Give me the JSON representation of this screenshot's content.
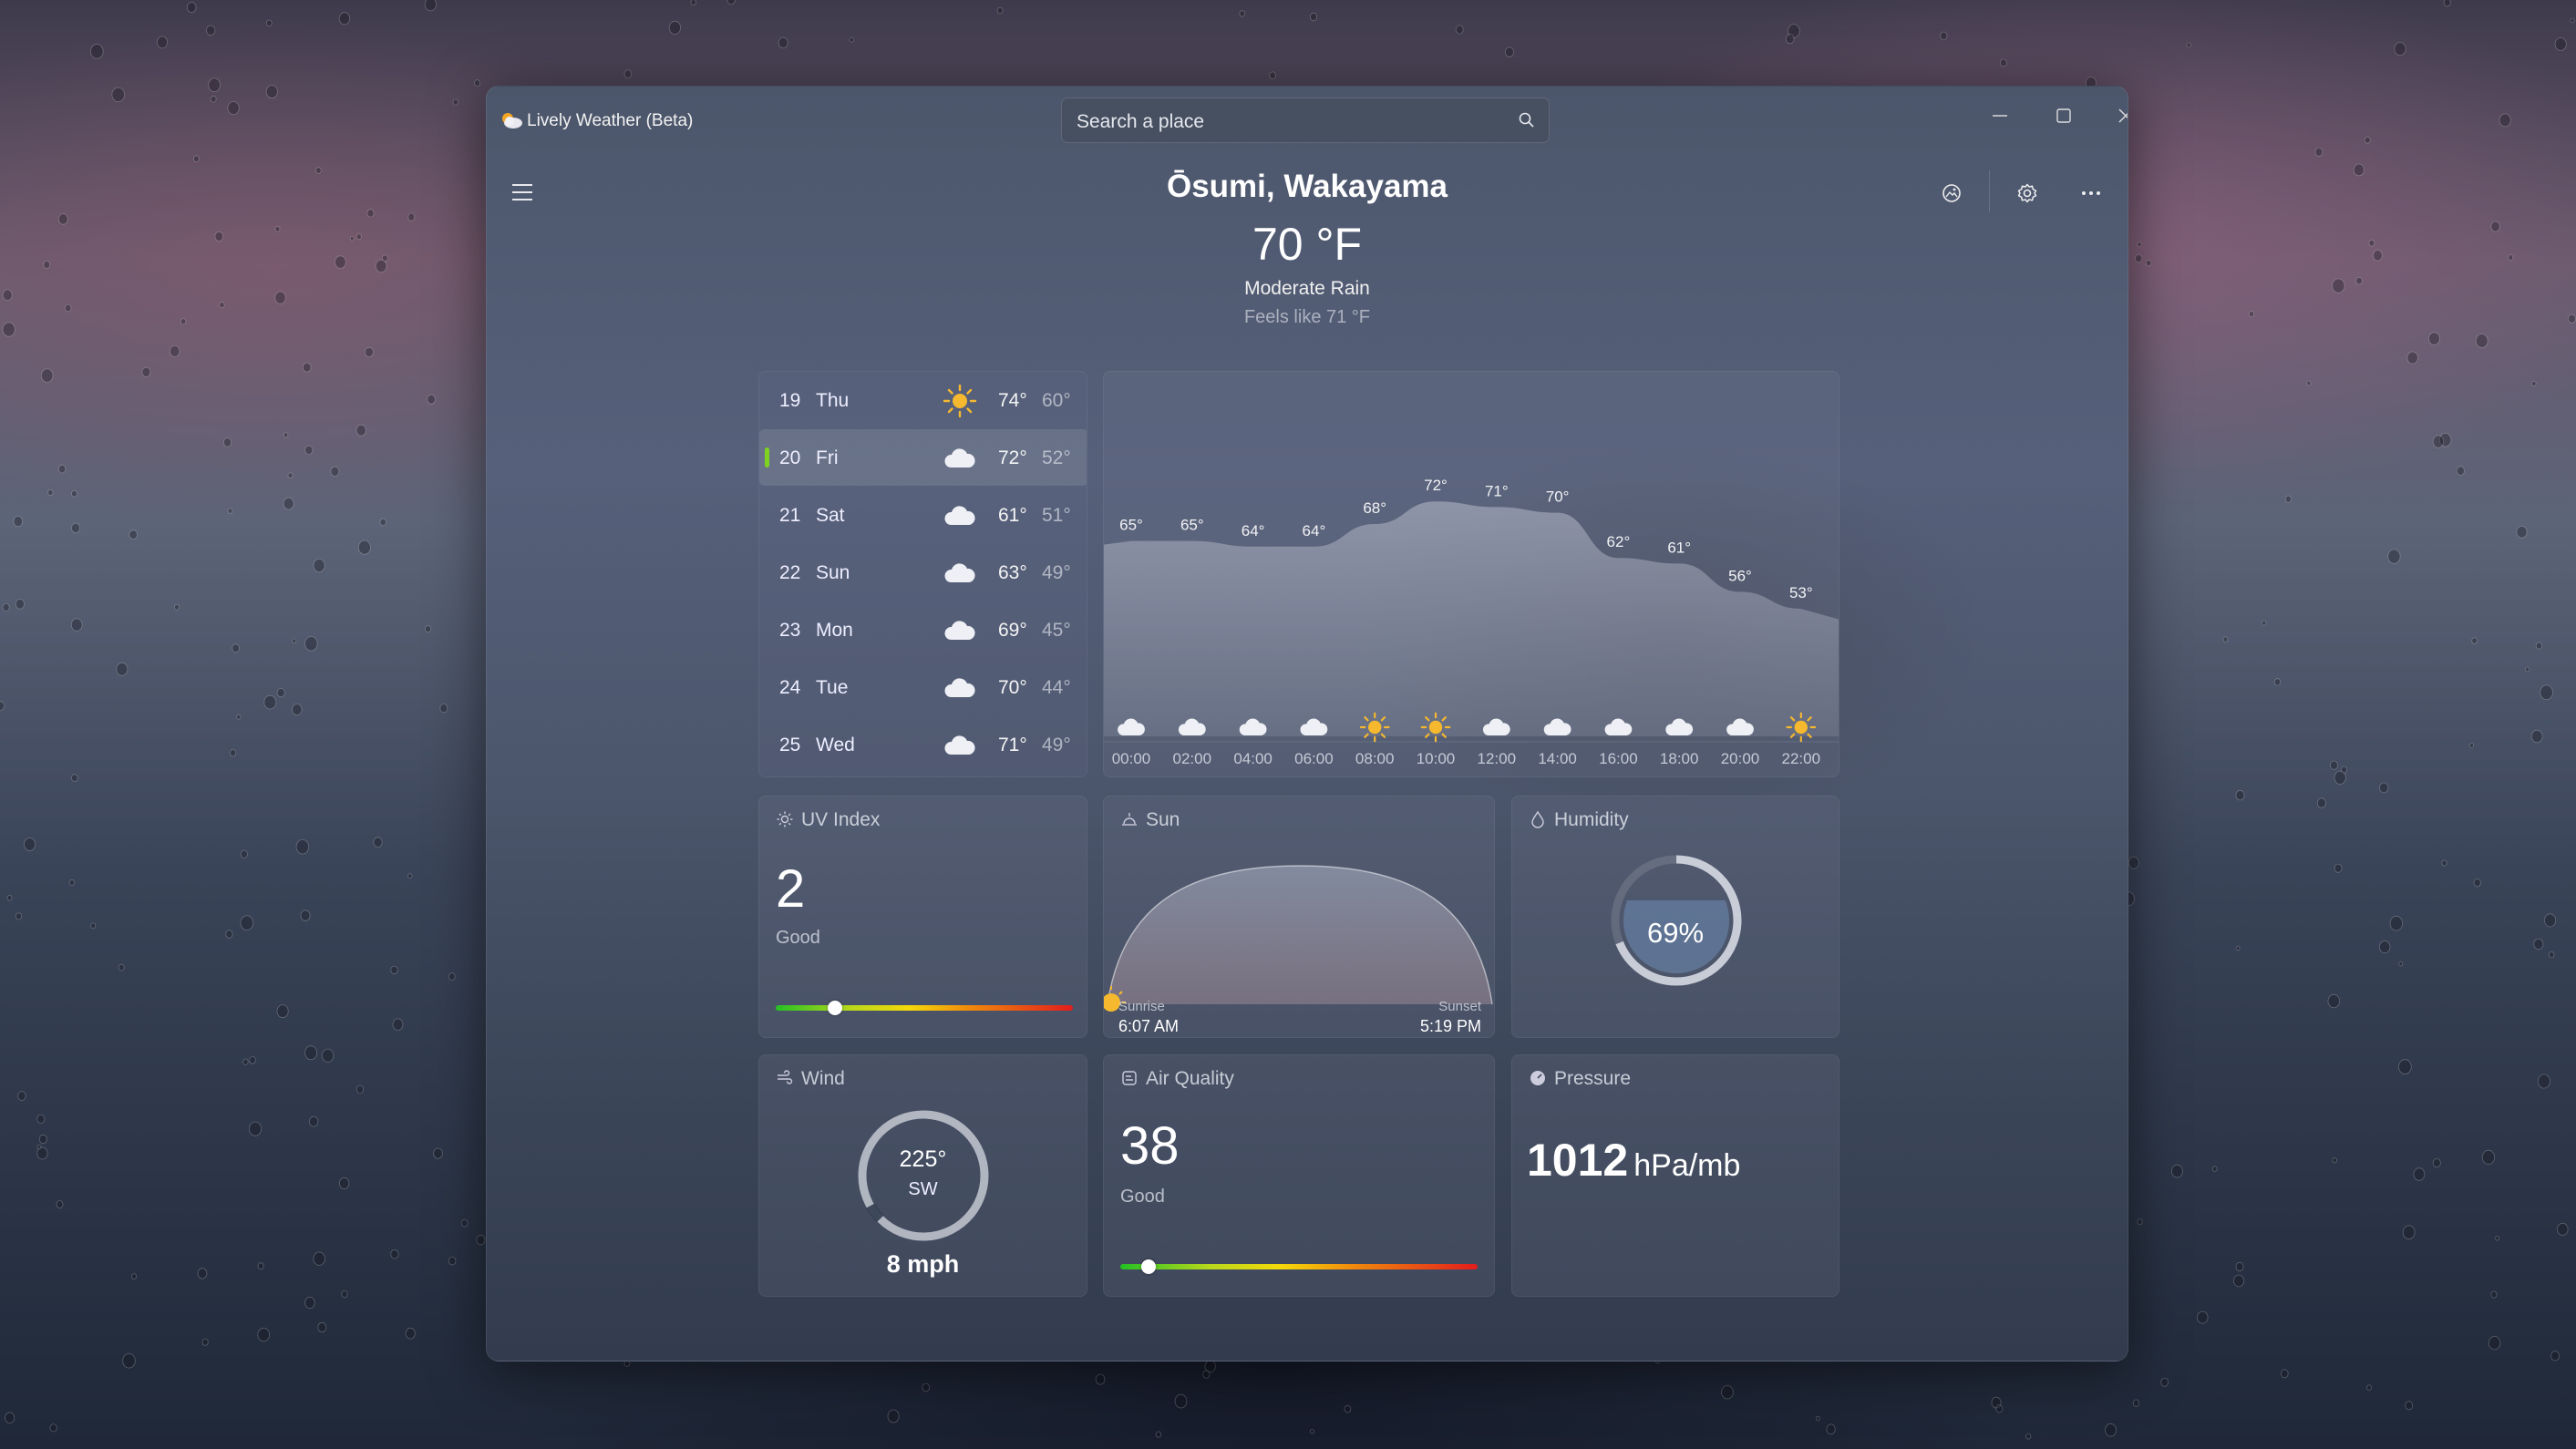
{
  "window": {
    "title": "Lively Weather (Beta)"
  },
  "search": {
    "placeholder": "Search a place"
  },
  "current": {
    "location": "Ōsumi, Wakayama",
    "temperature": "70 °F",
    "condition": "Moderate Rain",
    "feels_like": "Feels like 71 °F"
  },
  "forecast": [
    {
      "day": "19",
      "name": "Thu",
      "icon": "sun-icon",
      "high": "74°",
      "low": "60°",
      "selected": false
    },
    {
      "day": "20",
      "name": "Fri",
      "icon": "cloud-icon",
      "high": "72°",
      "low": "52°",
      "selected": true
    },
    {
      "day": "21",
      "name": "Sat",
      "icon": "cloud-icon",
      "high": "61°",
      "low": "51°",
      "selected": false
    },
    {
      "day": "22",
      "name": "Sun",
      "icon": "cloud-icon",
      "high": "63°",
      "low": "49°",
      "selected": false
    },
    {
      "day": "23",
      "name": "Mon",
      "icon": "cloud-icon",
      "high": "69°",
      "low": "45°",
      "selected": false
    },
    {
      "day": "24",
      "name": "Tue",
      "icon": "cloud-icon",
      "high": "70°",
      "low": "44°",
      "selected": false
    },
    {
      "day": "25",
      "name": "Wed",
      "icon": "cloud-icon",
      "high": "71°",
      "low": "49°",
      "selected": false
    }
  ],
  "hourly": {
    "times": [
      "00:00",
      "02:00",
      "04:00",
      "06:00",
      "08:00",
      "10:00",
      "12:00",
      "14:00",
      "16:00",
      "18:00",
      "20:00",
      "22:00"
    ],
    "temps": [
      65,
      65,
      64,
      64,
      68,
      72,
      71,
      70,
      62,
      61,
      56,
      53
    ],
    "labels": [
      "65°",
      "65°",
      "64°",
      "64°",
      "68°",
      "72°",
      "71°",
      "70°",
      "62°",
      "61°",
      "56°",
      "53°"
    ],
    "icons": [
      "cloud-icon",
      "cloud-icon",
      "cloud-icon",
      "cloud-icon",
      "sun-icon",
      "sun-icon",
      "cloud-icon",
      "cloud-icon",
      "cloud-icon",
      "cloud-icon",
      "cloud-icon",
      "sun-icon"
    ]
  },
  "uv": {
    "title": "UV Index",
    "value": "2",
    "label": "Good",
    "level": 0.2
  },
  "sun": {
    "title": "Sun",
    "sunrise_label": "Sunrise",
    "sunrise": "6:07 AM",
    "sunset_label": "Sunset",
    "sunset": "5:19 PM"
  },
  "humidity": {
    "title": "Humidity",
    "value": "69%",
    "fraction": 0.69
  },
  "wind": {
    "title": "Wind",
    "degrees": "225°",
    "direction": "SW",
    "speed": "8 mph"
  },
  "air_quality": {
    "title": "Air Quality",
    "value": "38",
    "label": "Good",
    "level": 0.08
  },
  "pressure": {
    "title": "Pressure",
    "value": "1012",
    "unit": "hPa/mb"
  },
  "colors": {
    "accent": "#7ed321",
    "sun": "#f5b82e"
  }
}
